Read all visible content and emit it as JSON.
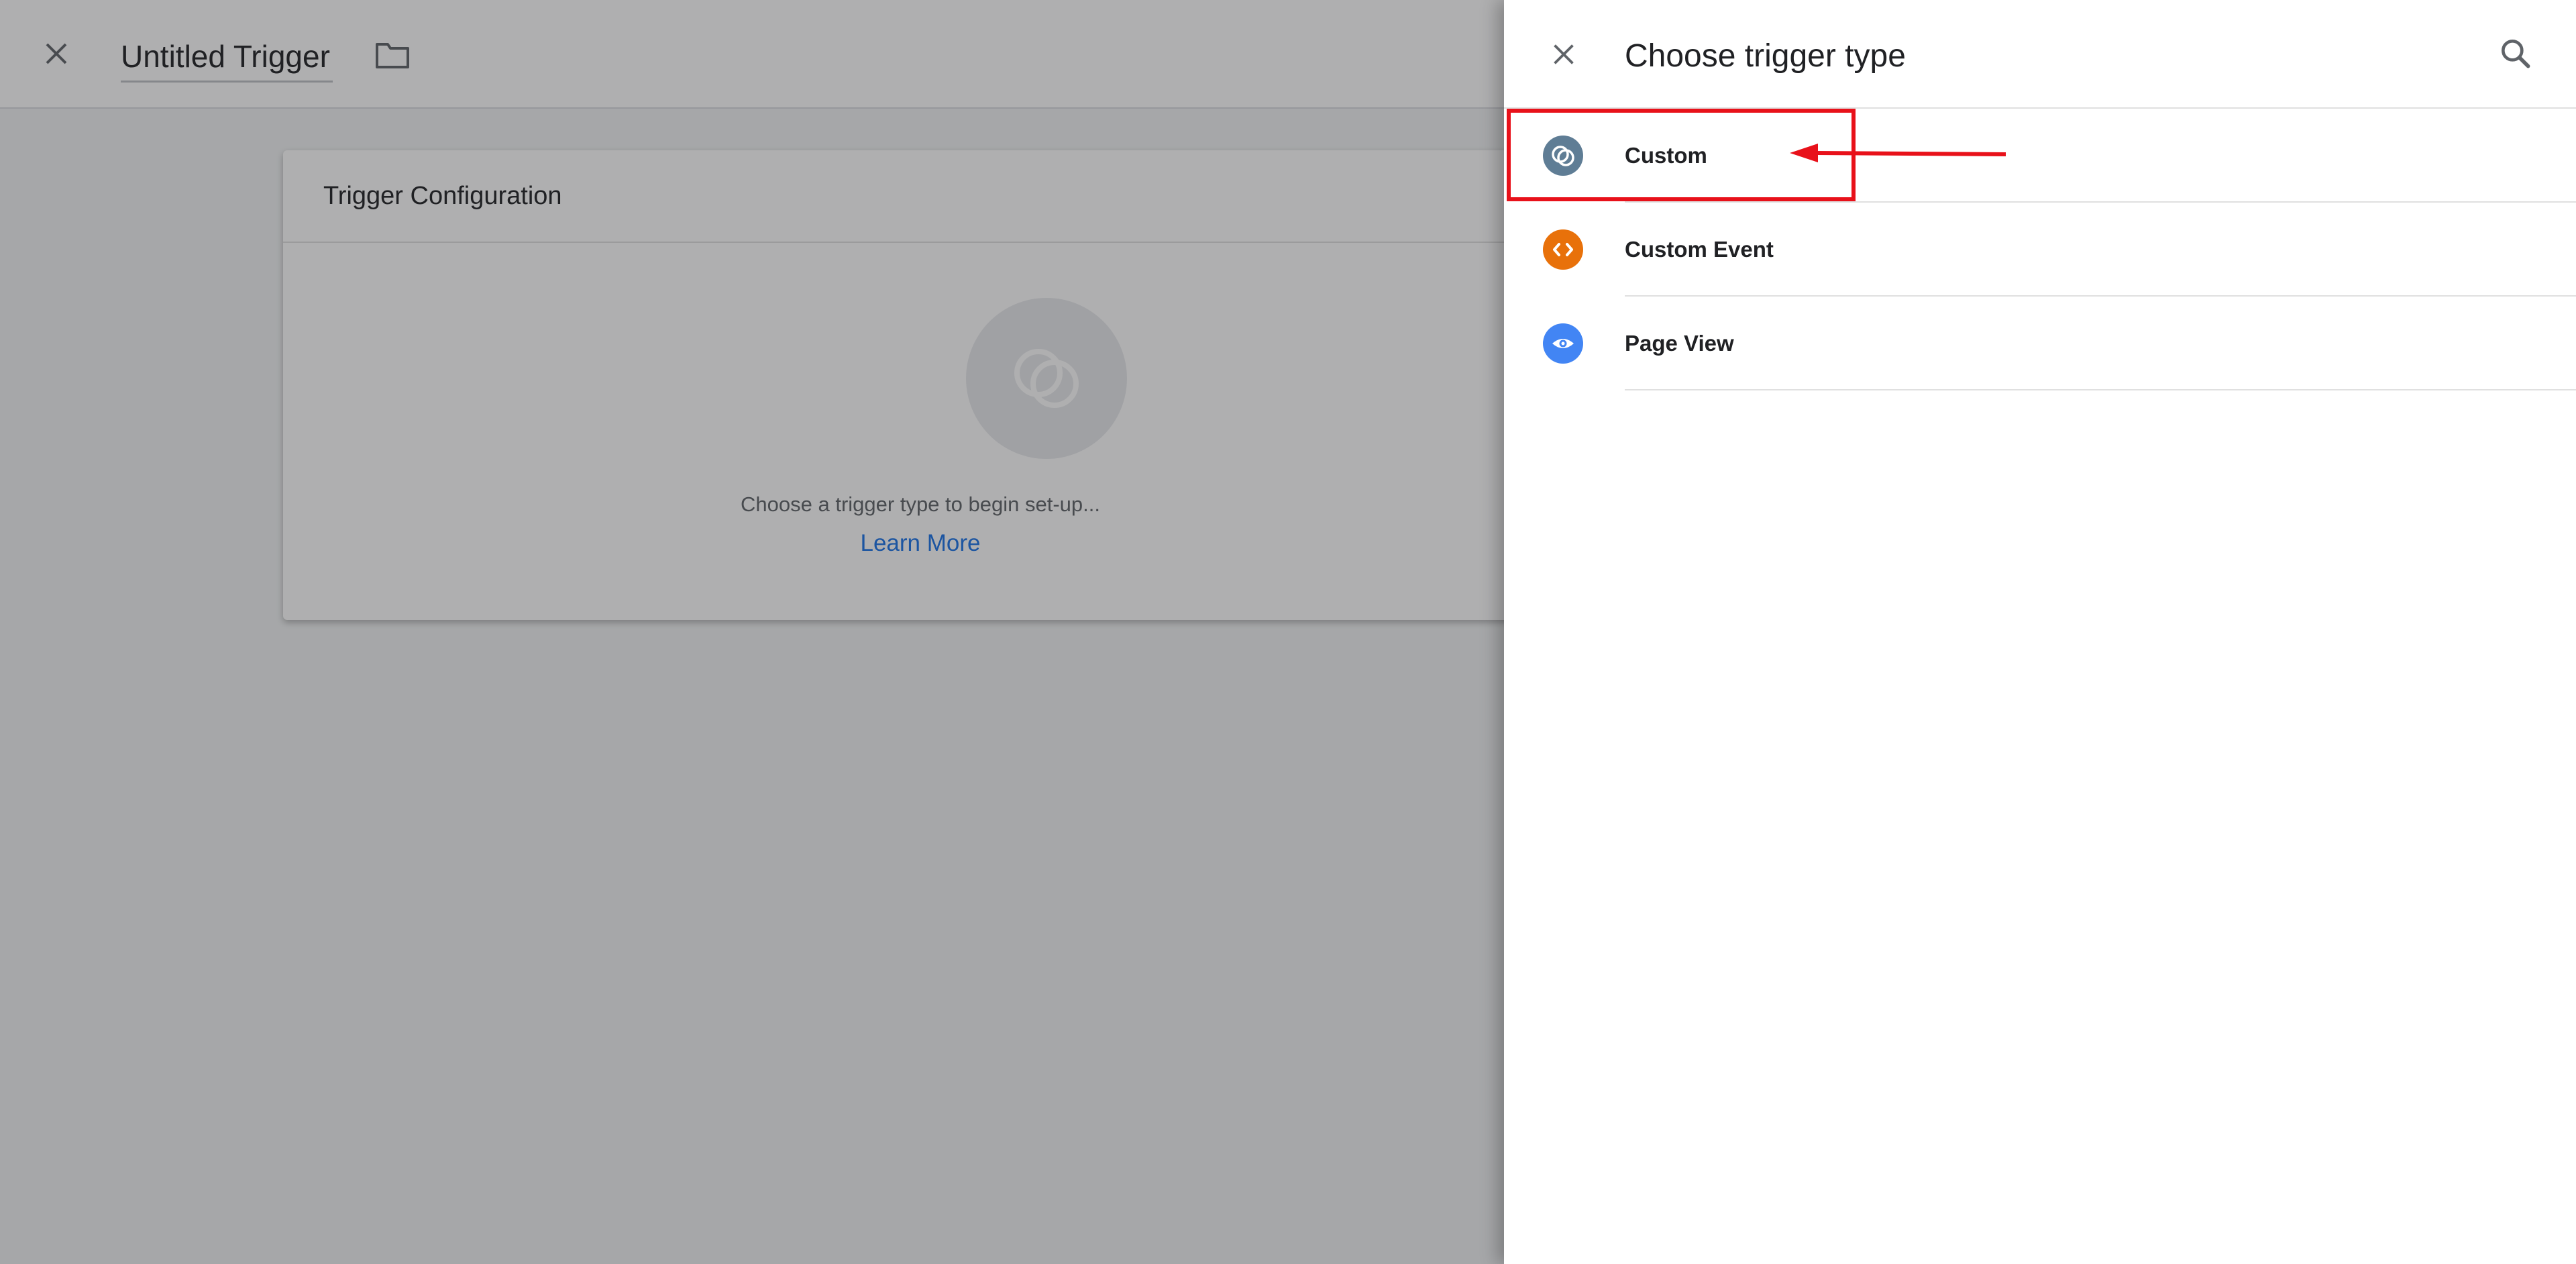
{
  "editor": {
    "trigger_name": "Untitled Trigger",
    "config_title": "Trigger Configuration",
    "config_hint": "Choose a trigger type to begin set-up...",
    "learn_more": "Learn More"
  },
  "panel": {
    "title": "Choose trigger type",
    "items": [
      {
        "label": "Custom",
        "icon": "custom-circles-icon",
        "color": "#5f7d95"
      },
      {
        "label": "Custom Event",
        "icon": "code-brackets-icon",
        "color": "#e8710a"
      },
      {
        "label": "Page View",
        "icon": "eye-icon",
        "color": "#4285f4"
      }
    ]
  },
  "colors": {
    "link": "#1a73e8",
    "highlight": "#e8111a"
  }
}
